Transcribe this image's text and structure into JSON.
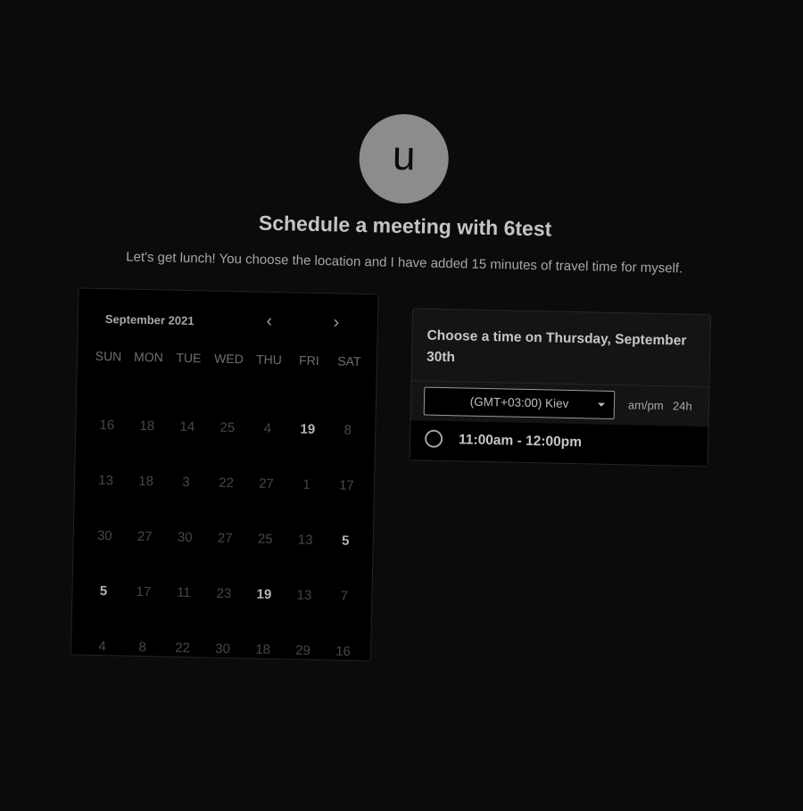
{
  "avatar": {
    "initial": "u"
  },
  "header": {
    "title": "Schedule a meeting with 6test",
    "subtitle": "Let's get lunch! You choose the location and I have added 15 minutes of travel time for myself."
  },
  "calendar": {
    "month": "September 2021",
    "prev_icon": "chevron-left-icon",
    "next_icon": "chevron-right-icon",
    "days_of_week": [
      "SUN",
      "MON",
      "TUE",
      "WED",
      "THU",
      "FRI",
      "SAT"
    ],
    "weeks": [
      [
        {
          "d": "16",
          "a": false
        },
        {
          "d": "18",
          "a": false
        },
        {
          "d": "14",
          "a": false
        },
        {
          "d": "25",
          "a": false
        },
        {
          "d": "4",
          "a": false
        },
        {
          "d": "19",
          "a": true
        },
        {
          "d": "8",
          "a": false
        }
      ],
      [
        {
          "d": "13",
          "a": false
        },
        {
          "d": "18",
          "a": false
        },
        {
          "d": "3",
          "a": false
        },
        {
          "d": "22",
          "a": false
        },
        {
          "d": "27",
          "a": false
        },
        {
          "d": "1",
          "a": false
        },
        {
          "d": "17",
          "a": false
        }
      ],
      [
        {
          "d": "30",
          "a": false
        },
        {
          "d": "27",
          "a": false
        },
        {
          "d": "30",
          "a": false
        },
        {
          "d": "27",
          "a": false
        },
        {
          "d": "25",
          "a": false
        },
        {
          "d": "13",
          "a": false
        },
        {
          "d": "5",
          "a": true
        }
      ],
      [
        {
          "d": "5",
          "a": true
        },
        {
          "d": "17",
          "a": false
        },
        {
          "d": "11",
          "a": false
        },
        {
          "d": "23",
          "a": false
        },
        {
          "d": "19",
          "a": true
        },
        {
          "d": "13",
          "a": false
        },
        {
          "d": "7",
          "a": false
        }
      ],
      [
        {
          "d": "4",
          "a": false
        },
        {
          "d": "8",
          "a": false
        },
        {
          "d": "22",
          "a": false
        },
        {
          "d": "30",
          "a": false
        },
        {
          "d": "18",
          "a": false
        },
        {
          "d": "29",
          "a": false
        },
        {
          "d": "16",
          "a": false
        }
      ]
    ]
  },
  "time_panel": {
    "heading": "Choose a time on Thursday, September 30th",
    "timezone": "(GMT+03:00) Kiev",
    "format_ampm": "am/pm",
    "format_24h": "24h",
    "slots": [
      {
        "label": "11:00am - 12:00pm"
      }
    ]
  }
}
